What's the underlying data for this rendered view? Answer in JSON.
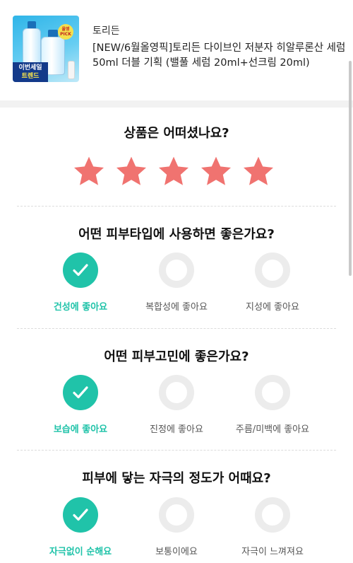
{
  "product": {
    "brand": "토리든",
    "name": "[NEW/6월올영픽]토리든 다이브인 저분자 히알루론산 세럼 50ml 더블 기획 (밸풀 세럼 20ml+선크림 20ml)",
    "thumb_pick_text": "올영 PICK",
    "thumb_badge_line1": "이번세일",
    "thumb_badge_line2": "트렌드"
  },
  "rating": {
    "question": "상품은 어떠셨나요?",
    "value": 5,
    "max": 5,
    "star_color": "#f07370"
  },
  "skin_type": {
    "question": "어떤 피부타입에 사용하면 좋은가요?",
    "options": [
      {
        "label": "건성에 좋아요",
        "selected": true
      },
      {
        "label": "복합성에 좋아요",
        "selected": false
      },
      {
        "label": "지성에 좋아요",
        "selected": false
      }
    ]
  },
  "skin_concern": {
    "question": "어떤 피부고민에 좋은가요?",
    "options": [
      {
        "label": "보습에 좋아요",
        "selected": true
      },
      {
        "label": "진정에 좋아요",
        "selected": false
      },
      {
        "label": "주름/미백에 좋아요",
        "selected": false
      }
    ]
  },
  "irritation": {
    "question": "피부에 닿는 자극의 정도가 어때요?",
    "options": [
      {
        "label": "자극없이 순해요",
        "selected": true
      },
      {
        "label": "보통이에요",
        "selected": false
      },
      {
        "label": "자극이 느껴져요",
        "selected": false
      }
    ]
  },
  "colors": {
    "accent": "#20c3a9",
    "unselected_ring": "#ececec"
  }
}
